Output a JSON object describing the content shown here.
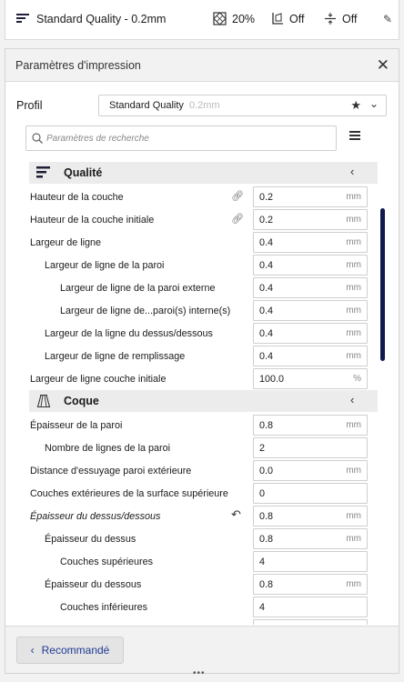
{
  "topbar": {
    "profile_label": "Standard Quality - 0.2mm",
    "infill_label": "20%",
    "support_label": "Off",
    "adhesion_label": "Off"
  },
  "panel": {
    "title": "Paramètres d'impression",
    "profile_label": "Profil",
    "profile_value": "Standard Quality",
    "profile_sub": "0.2mm",
    "search_placeholder": "Paramètres de recherche",
    "recommended_button": "Recommandé"
  },
  "categories": {
    "quality": "Qualité",
    "shell": "Coque"
  },
  "quality_settings": [
    {
      "label": "Hauteur de la couche",
      "value": "0.2",
      "unit": "mm"
    },
    {
      "label": "Hauteur de la couche initiale",
      "value": "0.2",
      "unit": "mm"
    },
    {
      "label": "Largeur de ligne",
      "value": "0.4",
      "unit": "mm"
    },
    {
      "label": "Largeur de ligne de la paroi",
      "value": "0.4",
      "unit": "mm"
    },
    {
      "label": "Largeur de ligne de la paroi externe",
      "value": "0.4",
      "unit": "mm"
    },
    {
      "label": "Largeur de ligne de...paroi(s) interne(s)",
      "value": "0.4",
      "unit": "mm"
    },
    {
      "label": "Largeur de la ligne du dessus/dessous",
      "value": "0.4",
      "unit": "mm"
    },
    {
      "label": "Largeur de ligne de remplissage",
      "value": "0.4",
      "unit": "mm"
    },
    {
      "label": "Largeur de ligne couche initiale",
      "value": "100.0",
      "unit": "%"
    }
  ],
  "shell_settings": [
    {
      "label": "Épaisseur de la paroi",
      "value": "0.8",
      "unit": "mm"
    },
    {
      "label": "Nombre de lignes de la paroi",
      "value": "2",
      "unit": ""
    },
    {
      "label": "Distance d'essuyage paroi extérieure",
      "value": "0.0",
      "unit": "mm"
    },
    {
      "label": "Couches extérieures de la surface supérieure",
      "value": "0",
      "unit": ""
    },
    {
      "label": "Épaisseur du dessus/dessous",
      "value": "0.8",
      "unit": "mm"
    },
    {
      "label": "Épaisseur du dessus",
      "value": "0.8",
      "unit": "mm"
    },
    {
      "label": "Couches supérieures",
      "value": "4",
      "unit": ""
    },
    {
      "label": "Épaisseur du dessous",
      "value": "0.8",
      "unit": "mm"
    },
    {
      "label": "Couches inférieures",
      "value": "4",
      "unit": ""
    }
  ],
  "icons": [
    "profile-lines-icon",
    "infill-icon",
    "support-icon",
    "adhesion-icon",
    "edit-pencil-icon",
    "close-icon",
    "star-icon",
    "chevron-down-icon",
    "search-icon",
    "menu-icon",
    "chevron-left-icon",
    "link-icon",
    "reset-icon"
  ],
  "colors": {
    "accent": "#1f3a93",
    "scrollbar": "#0f1a4d",
    "category_bg": "#ececec"
  }
}
